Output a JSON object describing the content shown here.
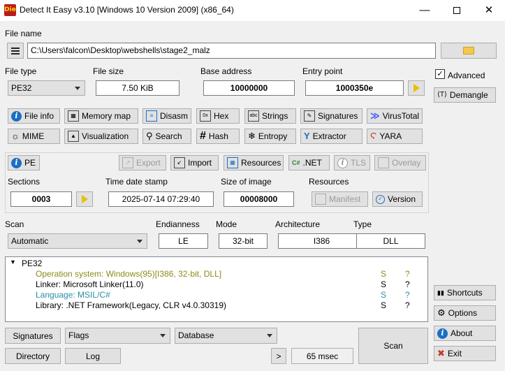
{
  "window": {
    "title": "Detect It Easy v3.10 [Windows 10 Version 2009] (x86_64)",
    "app_icon_text": "Die"
  },
  "file_name": {
    "label": "File name",
    "path": "C:\\Users\\falcon\\Desktop\\webshells\\stage2_malz"
  },
  "file_type": {
    "label": "File type",
    "value": "PE32"
  },
  "file_size": {
    "label": "File size",
    "value": "7.50 KiB"
  },
  "base_address": {
    "label": "Base address",
    "value": "10000000"
  },
  "entry_point": {
    "label": "Entry point",
    "value": "1000350e"
  },
  "right_panel": {
    "advanced_label": "Advanced",
    "advanced_checked": true,
    "demangle": "Demangle",
    "shortcuts": "Shortcuts",
    "options": "Options",
    "about": "About",
    "exit": "Exit"
  },
  "tools_row1": [
    "File info",
    "Memory map",
    "Disasm",
    "Hex",
    "Strings",
    "Signatures",
    "VirusTotal"
  ],
  "tools_row2": [
    "MIME",
    "Visualization",
    "Search",
    "Hash",
    "Entropy",
    "Extractor",
    "YARA"
  ],
  "pe_row": {
    "pe": "PE",
    "export": "Export",
    "import": "Import",
    "resources": "Resources",
    "net": ".NET",
    "tls": "TLS",
    "overlay": "Overlay"
  },
  "sections": {
    "label": "Sections",
    "value": "0003"
  },
  "time_date_stamp": {
    "label": "Time date stamp",
    "value": "2025-07-14 07:29:40"
  },
  "size_of_image": {
    "label": "Size of image",
    "value": "00008000"
  },
  "resources": {
    "label": "Resources",
    "manifest": "Manifest",
    "version": "Version"
  },
  "scan": {
    "label": "Scan",
    "value": "Automatic"
  },
  "endianness": {
    "label": "Endianness",
    "value": "LE"
  },
  "mode": {
    "label": "Mode",
    "value": "32-bit"
  },
  "architecture": {
    "label": "Architecture",
    "value": "I386"
  },
  "type": {
    "label": "Type",
    "value": "DLL"
  },
  "results": {
    "root": "PE32",
    "items": [
      {
        "text": "Operation system: Windows(95)[I386, 32-bit, DLL]",
        "s": "S",
        "q": "?",
        "color": "#8b8b1a"
      },
      {
        "text": "Linker: Microsoft Linker(11.0)",
        "s": "S",
        "q": "?",
        "color": "#000000"
      },
      {
        "text": "Language: MSIL/C#",
        "s": "S",
        "q": "?",
        "color": "#2b8ca8"
      },
      {
        "text": "Library: .NET Framework(Legacy, CLR v4.0.30319)",
        "s": "S",
        "q": "?",
        "color": "#000000"
      }
    ]
  },
  "bottom": {
    "signatures": "Signatures",
    "flags": "Flags",
    "database": "Database",
    "directory": "Directory",
    "log": "Log",
    "more": ">",
    "elapsed": "65 msec",
    "scan": "Scan"
  }
}
